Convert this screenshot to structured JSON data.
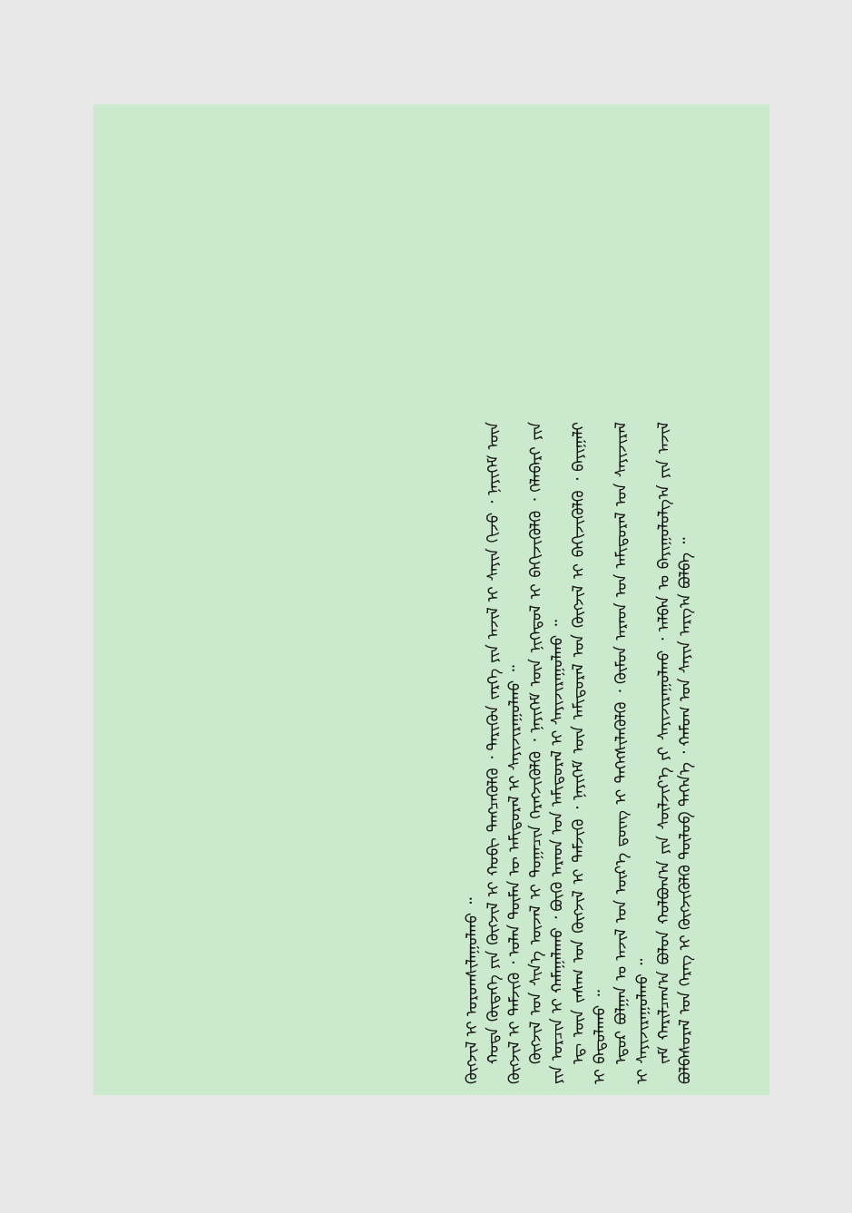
{
  "colors": {
    "page_background": "#e8e8e8",
    "panel_background": "#cbe9cd",
    "text": "#111111"
  },
  "paragraphs": [
    "ᠪᠣᠯᠪᠠᠰᠤᠷᠠᠯ ᠤᠨ ᠬᠡᠷᠡᠭ ᠢ ᠬᠥᠭᠵᠢᠭᠦᠯᠬᠦ ᠲᠥᠯᠥᠪ ᠳᠡᠭᠡᠨ᠎ᠡ ᠂ ᠬᠠᠮᠤᠭ ᠤᠨ ᠰᠠᠶᠢᠨ ᠠᠷᠭ᠎ᠠ ᠪᠣᠯᠪᠠ ᠃",
    "ᠵᠠᠮ ᠬᠠᠷᠢᠯᠴᠠᠭ᠎ᠠ ᠪᠣᠯᠣᠨ ᠬᠣᠯᠪᠣᠭ᠎ᠠ ᠶᠢᠨ ᠰᠦᠯᠵᠢᠶ᠎ᠡ ᠶᠢ ᠰᠠᠶᠢᠵᠢᠷᠠᠭᠤᠯᠬᠤ ᠂ ᠠᠯᠪᠠᠨ ᠤ ᠪᠠᠶᠢᠭᠤᠯᠤᠯᠭ᠎ᠠ ᠶᠢᠨ ᠠᠵᠢᠯ ᠢ ᠰᠠᠶᠢᠵᠢᠷᠠᠭᠤᠯᠬᠤ ᠃",
    "ᠡᠳᠦᠷ ᠪᠣᠯᠭᠠᠨ ᠤ ᠠᠵᠢᠯ ᠤᠨ ᠦᠷ᠎ᠡ ᠳ᠋ᠦᠩ ᠢ ᠳᠡᠭᠡᠭᠰᠢᠯᠡᠭᠦᠯᠬᠦ ᠂ ᠬᠦᠮᠦᠨ ᠠᠷᠠᠳ ᠤᠨ ᠠᠮᠢᠳᠤᠷᠠᠯ ᠤᠨ ᠰᠠᠶᠢᠵᠢᠷᠠᠯ ᠢ ᠪᠠᠲᠤᠯᠠᠬᠤ ᠃",
    "ᠡᠳ᠋ ᠦᠨ ᠵᠠᠰᠠᠭ ᠤᠨ ᠬᠥᠭᠵᠢᠯ ᠢ ᠳᠡᠮᠵᠢᠬᠦ ᠂ ᠨᠡᠶᠢᠭᠡᠮ ᠦᠨ ᠠᠮᠢᠳᠤᠷᠠᠯ ᠤᠨ ᠬᠥᠭᠵᠢᠯ ᠢ ᠪᠡᠬᠢᠵᠢᠭᠦᠯᠬᠦ ᠂ ᠪᠠᠶᠢᠭᠠᠯᠢ ᠶᠢᠨ ᠣᠷᠴᠢᠨ ᠢ ᠬᠠᠮᠠᠭᠠᠯᠠᠬᠤ ᠂ ᠪᠦᠬᠦ ᠠᠷᠠᠳ ᠤᠨ ᠠᠮᠢᠳᠤᠷᠠᠯ ᠢ ᠰᠠᠶᠢᠵᠢᠷᠠᠭᠤᠯᠬᠤ ᠃",
    "ᠬᠥᠭᠵᠢᠯ ᠤᠨ ᠰᠢᠨ᠎ᠡ ᠦᠵᠡᠯ ᠢ ᠲᠤᠭᠠᠴᠢᠨ ᠬᠡᠷᠡᠭᠵᠢᠭᠦᠯᠬᠦ ᠂ ᠨᠡᠶᠢᠭᠡᠮ ᠦᠨ ᠨᠢᠭᠡᠳᠦᠯ ᠢ ᠪᠡᠬᠢᠵᠢᠭᠦᠯᠬᠦ ᠂ ᠬᠡᠯᠡᠪᠡᠷᠢ ᠶᠢᠨ ᠬᠥᠭᠵᠢᠯ ᠢ ᠳᠡᠮᠵᠢᠬᠦ ᠂ ᠣᠯᠠᠨ ᠲᠦᠮᠡᠨ ᠦ ᠠᠮᠢᠳᠤᠷᠠᠯ ᠢ ᠰᠠᠶᠢᠵᠢᠷᠠᠭᠤᠯᠬᠤ ᠃",
    "ᠬᠣᠲᠠ ᠬᠥᠳᠡᠭᠡ ᠶᠢᠨ ᠬᠥᠭᠵᠢᠯ ᠢ ᠬᠤᠪᠢ ᠲᠡᠩᠴᠡᠭᠦᠯᠬᠦ ᠂ ᠲᠡᠷᠢᠭᠦᠨ ᠵᠡᠷᠭᠡ ᠶᠢᠨ ᠠᠵᠢᠯ ᠢ ᠰᠠᠶᠢᠨ ᠬᠢᠵᠦ ᠂ ᠨᠡᠶᠢᠭᠡᠮ ᠦᠨ ᠬᠥᠭᠵᠢᠯ ᠢ ᠤᠷᠤᠭᠰᠢᠯᠠᠭᠤᠯᠬᠤ ᠃"
  ]
}
